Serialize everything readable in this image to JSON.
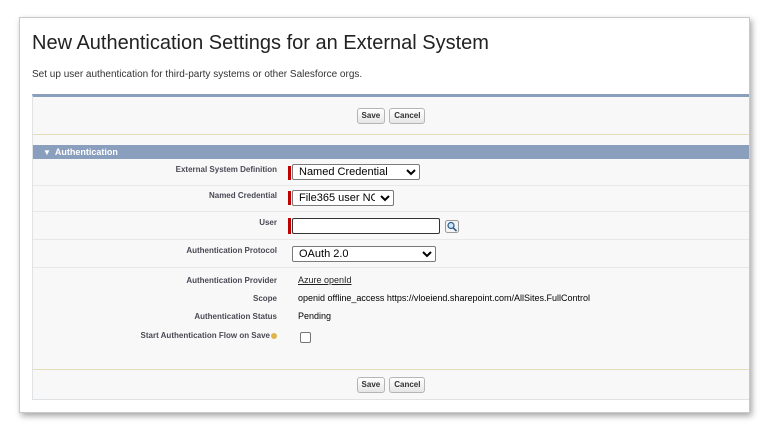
{
  "page": {
    "title": "New Authentication Settings for an External System",
    "description": "Set up user authentication for third-party systems or other Salesforce orgs."
  },
  "buttons": {
    "save_label": "Save",
    "cancel_label": "Cancel"
  },
  "section": {
    "title": "Authentication",
    "toggle_glyph": "▼"
  },
  "fields": {
    "external_system_definition": {
      "label": "External System Definition",
      "value": "Named Credential"
    },
    "named_credential": {
      "label": "Named Credential",
      "value": "File365 user NC"
    },
    "user": {
      "label": "User",
      "value": ""
    },
    "authentication_protocol": {
      "label": "Authentication Protocol",
      "value": "OAuth 2.0"
    },
    "authentication_provider": {
      "label": "Authentication Provider",
      "value": "Azure openId"
    },
    "scope": {
      "label": "Scope",
      "value": "openid offline_access https://vloeiend.sharepoint.com/AllSites.FullControl"
    },
    "authentication_status": {
      "label": "Authentication Status",
      "value": "Pending"
    },
    "start_auth_flow": {
      "label": "Start Authentication Flow on Save",
      "checked": false
    }
  },
  "icons": {
    "lookup": "magnifier-lookup-icon",
    "help": "help-icon",
    "collapse": "triangle-down-icon"
  },
  "colors": {
    "section_header": "#8a9ebe",
    "required_bar": "#c00000",
    "panel_bg": "#f8f8f8"
  }
}
